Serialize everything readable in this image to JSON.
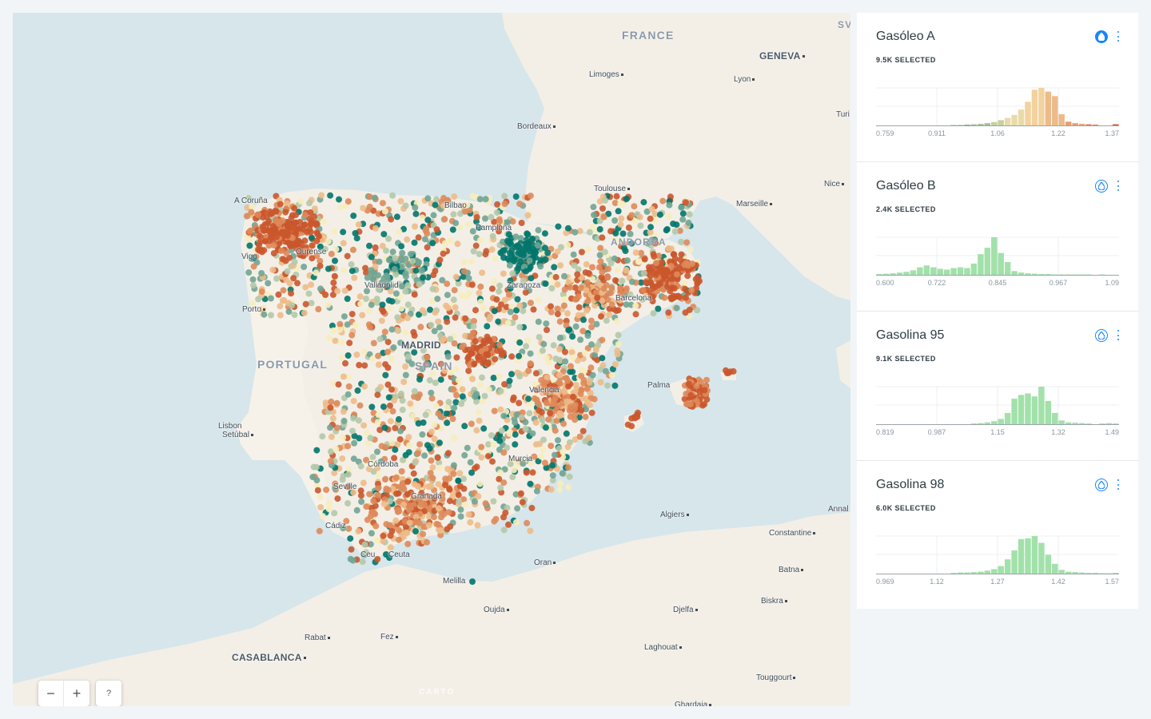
{
  "map": {
    "countries": [
      {
        "name": "FRANCE",
        "cls": ""
      },
      {
        "name": "PORTUGAL",
        "cls": ""
      },
      {
        "name": "SPAIN",
        "cls": ""
      },
      {
        "name": "ANDORRA",
        "cls": "small"
      },
      {
        "name": "SV",
        "cls": "small"
      }
    ],
    "places": [
      {
        "name": "GENEVA",
        "cls": "big dot"
      },
      {
        "name": "Limoges",
        "cls": "dot"
      },
      {
        "name": "Lyon",
        "cls": "dot"
      },
      {
        "name": "Bordeaux",
        "cls": "dot"
      },
      {
        "name": "Turi",
        "cls": ""
      },
      {
        "name": "Toulouse",
        "cls": "dot"
      },
      {
        "name": "Nice",
        "cls": "dot"
      },
      {
        "name": "Marseille",
        "cls": "dot"
      },
      {
        "name": "A Coruña",
        "cls": ""
      },
      {
        "name": "Bilbao",
        "cls": ""
      },
      {
        "name": "Pamplona",
        "cls": ""
      },
      {
        "name": "Vigo",
        "cls": ""
      },
      {
        "name": "Ourense",
        "cls": ""
      },
      {
        "name": "Valladolid",
        "cls": ""
      },
      {
        "name": "Zaragoza",
        "cls": ""
      },
      {
        "name": "Barcelona",
        "cls": ""
      },
      {
        "name": "Porto",
        "cls": "dot"
      },
      {
        "name": "MADRID",
        "cls": "big"
      },
      {
        "name": "Palma",
        "cls": ""
      },
      {
        "name": "Valencia",
        "cls": ""
      },
      {
        "name": "Lisbon",
        "cls": ""
      },
      {
        "name": "Setúbal",
        "cls": "dot"
      },
      {
        "name": "Córdoba",
        "cls": ""
      },
      {
        "name": "Murcia",
        "cls": ""
      },
      {
        "name": "Seville",
        "cls": ""
      },
      {
        "name": "Granada",
        "cls": ""
      },
      {
        "name": "Algiers",
        "cls": "dot"
      },
      {
        "name": "Annal",
        "cls": ""
      },
      {
        "name": "Cádiz",
        "cls": ""
      },
      {
        "name": "Constantine",
        "cls": "dot"
      },
      {
        "name": "Ceu",
        "cls": ""
      },
      {
        "name": "Ceuta",
        "cls": ""
      },
      {
        "name": "Oran",
        "cls": "dot"
      },
      {
        "name": "Batna",
        "cls": "dot"
      },
      {
        "name": "Melilla",
        "cls": ""
      },
      {
        "name": "Oujda",
        "cls": "dot"
      },
      {
        "name": "Djelfa",
        "cls": "dot"
      },
      {
        "name": "Biskra",
        "cls": "dot"
      },
      {
        "name": "Rabat",
        "cls": "dot"
      },
      {
        "name": "Fez",
        "cls": "dot"
      },
      {
        "name": "Laghouat",
        "cls": "dot"
      },
      {
        "name": "CASABLANCA",
        "cls": "big dot"
      },
      {
        "name": "Touggourt",
        "cls": "dot"
      },
      {
        "name": "Ghardaia",
        "cls": "dot"
      }
    ],
    "zoom_out": "−",
    "zoom_in": "+",
    "help": "?",
    "attribution": "CARTO"
  },
  "colors": {
    "low": "#00766c",
    "mid_low": "#70a494",
    "mid": "#f6edbd",
    "mid_high": "#edbb8a",
    "high": "#ca562c",
    "widget_green": "#a2e1aa",
    "accent": "#1785fb"
  },
  "widgets": [
    {
      "title": "Gasóleo A",
      "count": "9.5K SELECTED",
      "color_by": true,
      "drop_icon": "water-drop-icon",
      "ticks": [
        "0.759",
        "0.911",
        "1.06",
        "1.22",
        "1.37"
      ],
      "bins": [
        0,
        0,
        0,
        0,
        0,
        0,
        0,
        0,
        0,
        0,
        0,
        0.01,
        0.01,
        0.02,
        0.03,
        0.04,
        0.06,
        0.09,
        0.14,
        0.2,
        0.28,
        0.42,
        0.63,
        0.95,
        1.0,
        0.9,
        0.78,
        0.3,
        0.1,
        0.06,
        0.04,
        0.03,
        0.02,
        0,
        0,
        0.03
      ]
    },
    {
      "title": "Gasóleo B",
      "count": "2.4K SELECTED",
      "color_by": false,
      "drop_icon": "water-drop-icon",
      "ticks": [
        "0.600",
        "0.722",
        "0.845",
        "0.967",
        "1.09"
      ],
      "bins": [
        0.02,
        0.03,
        0.04,
        0.06,
        0.08,
        0.12,
        0.2,
        0.25,
        0.2,
        0.16,
        0.14,
        0.18,
        0.2,
        0.18,
        0.3,
        0.55,
        0.72,
        1.0,
        0.58,
        0.34,
        0.1,
        0.06,
        0.04,
        0.03,
        0.02,
        0.02,
        0.01,
        0.01,
        0.01,
        0.01,
        0.01,
        0.01,
        0,
        0.01,
        0,
        0
      ]
    },
    {
      "title": "Gasolina 95",
      "count": "9.1K SELECTED",
      "color_by": false,
      "drop_icon": "water-drop-icon",
      "ticks": [
        "0.819",
        "0.987",
        "1.15",
        "1.32",
        "1.49"
      ],
      "bins": [
        0,
        0,
        0,
        0,
        0,
        0,
        0,
        0,
        0,
        0,
        0,
        0,
        0,
        0,
        0.02,
        0.03,
        0.05,
        0.08,
        0.14,
        0.3,
        0.68,
        0.78,
        0.82,
        0.74,
        1.0,
        0.62,
        0.3,
        0.1,
        0.05,
        0.04,
        0.03,
        0.02,
        0,
        0.02,
        0.03,
        0.02
      ]
    },
    {
      "title": "Gasolina 98",
      "count": "6.0K SELECTED",
      "color_by": false,
      "drop_icon": "water-drop-icon",
      "ticks": [
        "0.969",
        "1.12",
        "1.27",
        "1.42",
        "1.57"
      ],
      "bins": [
        0,
        0,
        0,
        0,
        0,
        0,
        0,
        0,
        0,
        0,
        0,
        0.02,
        0.03,
        0.03,
        0.04,
        0.05,
        0.08,
        0.12,
        0.2,
        0.38,
        0.62,
        0.92,
        0.94,
        1.0,
        0.82,
        0.5,
        0.26,
        0.1,
        0.05,
        0.04,
        0.03,
        0.02,
        0.02,
        0.01,
        0.01,
        0.02
      ]
    }
  ]
}
